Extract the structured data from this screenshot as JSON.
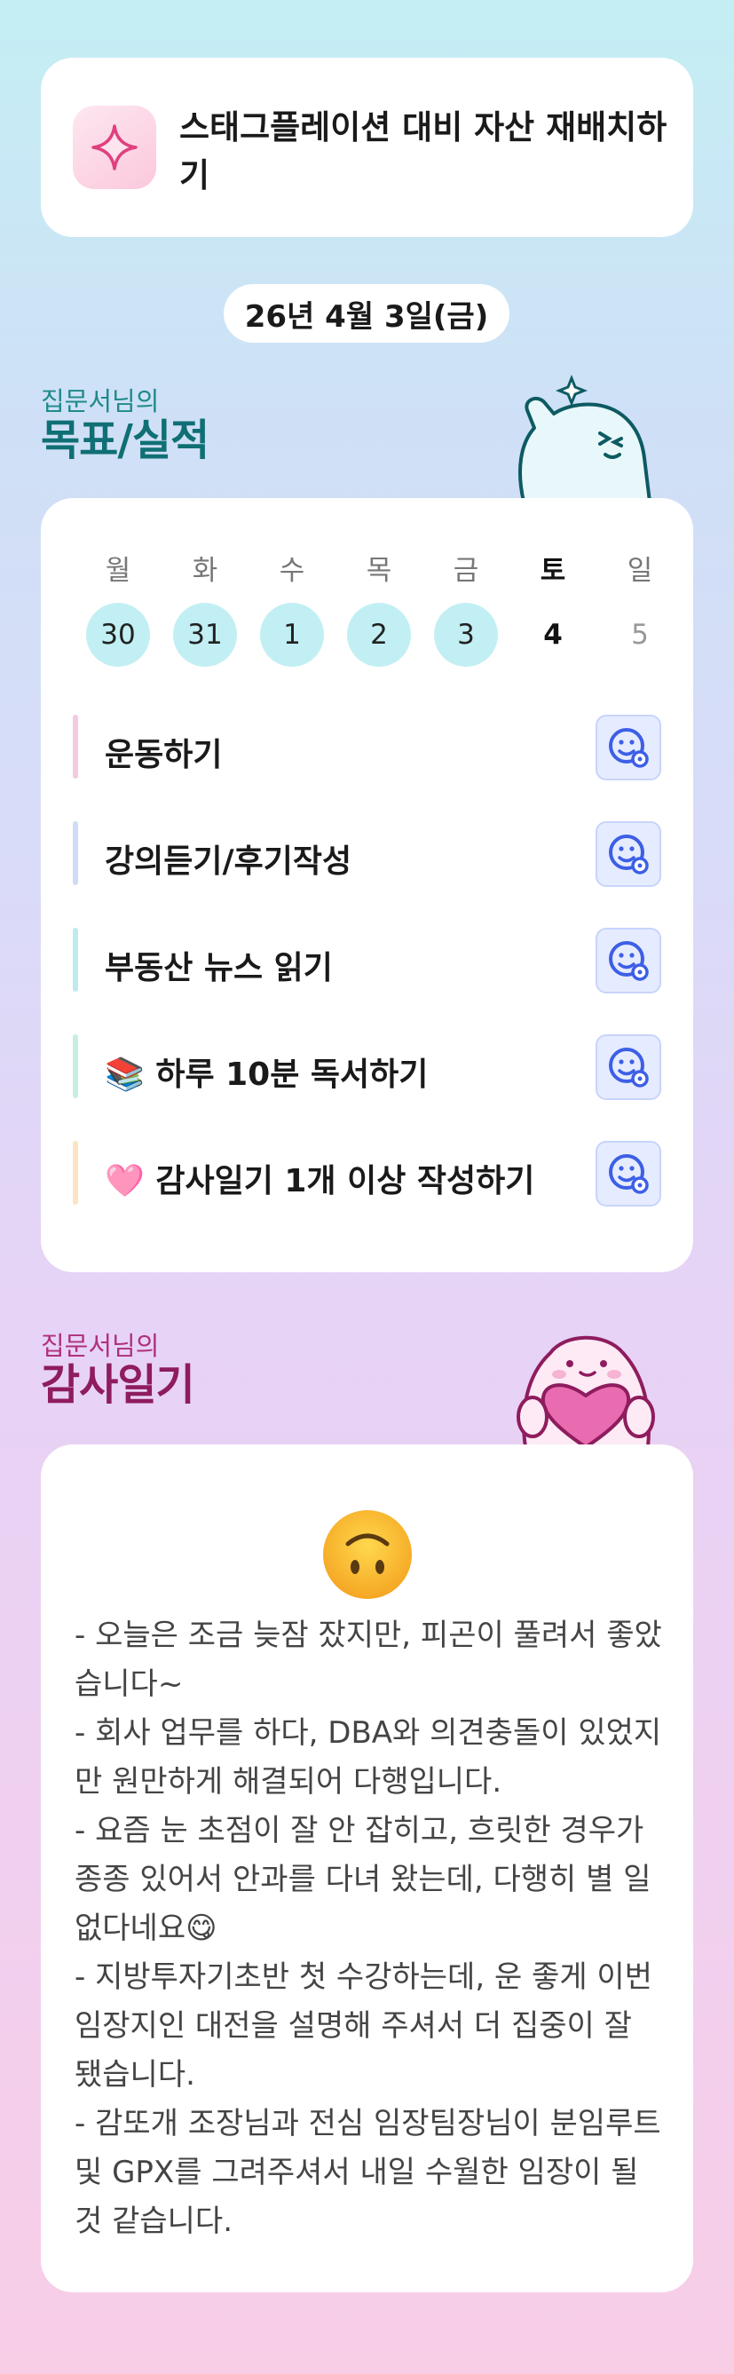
{
  "notice": {
    "title": "스태그플레이션 대비 자산 재배치하기",
    "icon": "sparkle-icon"
  },
  "date": "26년 4월 3일(금)",
  "goals_section": {
    "owner_label": "집문서님의",
    "title": "목표/실적"
  },
  "week": {
    "days": [
      "월",
      "화",
      "수",
      "목",
      "금",
      "토",
      "일"
    ],
    "dates": [
      {
        "num": "30",
        "state": "done"
      },
      {
        "num": "31",
        "state": "done"
      },
      {
        "num": "1",
        "state": "done"
      },
      {
        "num": "2",
        "state": "done"
      },
      {
        "num": "3",
        "state": "done"
      },
      {
        "num": "4",
        "state": "today"
      },
      {
        "num": "5",
        "state": "future"
      }
    ]
  },
  "goals": [
    {
      "label": "운동하기",
      "color": "#f6c8e2"
    },
    {
      "label": "강의듣기/후기작성",
      "color": "#cfdcf6"
    },
    {
      "label": "부동산 뉴스 읽기",
      "color": "#bfeaee"
    },
    {
      "label": "📚 하루 10분 독서하기",
      "color": "#c6efe0"
    },
    {
      "label": "🩷 감사일기 1개 이상 작성하기",
      "color": "#fbe3c4"
    }
  ],
  "gratitude_section": {
    "owner_label": "집문서님의",
    "title": "감사일기"
  },
  "gratitude": {
    "mood": "upside-down-face-emoji",
    "text": "- 오늘은 조금 늦잠 잤지만, 피곤이 풀려서 좋았습니다~\n- 회사 업무를 하다, DBA와 의견충돌이 있었지만 원만하게 해결되어 다행입니다.\n- 요즘 눈 초점이 잘 안 잡히고, 흐릿한 경우가 종종 있어서 안과를 다녀 왔는데, 다행히 별 일 없다네요😋\n- 지방투자기초반 첫 수강하는데, 운 좋게 이번 임장지인 대전을 설명해 주셔서 더 집중이 잘 됐습니다.\n- 감또개 조장님과 전심 임장팀장님이 분임루트 및 GPX를 그려주셔서 내일 수월한 임장이 될것 같습니다."
  },
  "colors": {
    "goals_heading": "#0f6f74",
    "gratitude_heading": "#8e1c5e",
    "done_day": "#c2eff3",
    "action_icon": "#3d5fe6"
  }
}
